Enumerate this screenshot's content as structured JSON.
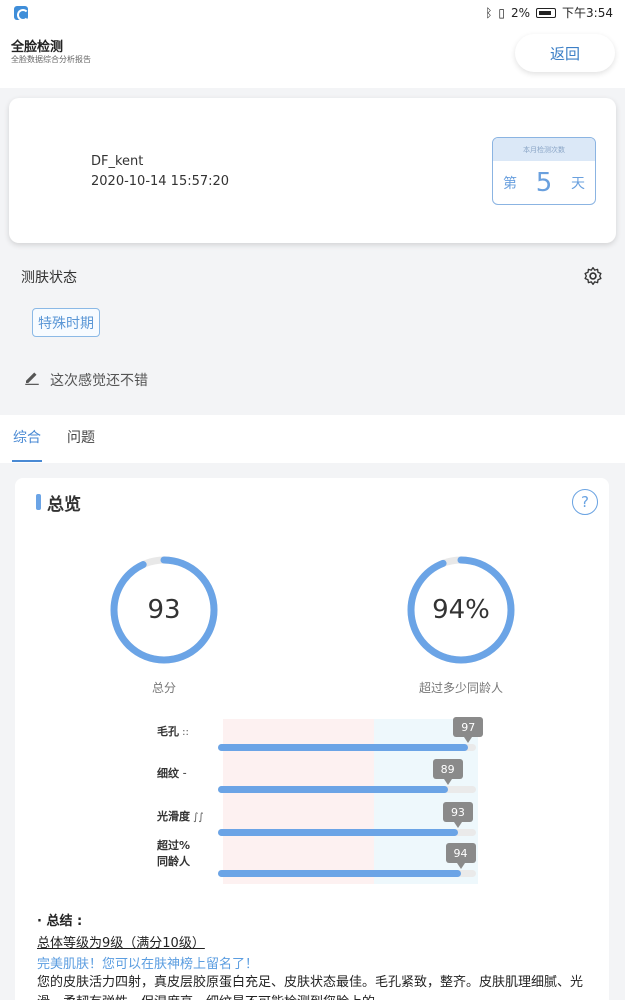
{
  "status_bar": {
    "battery": "2%",
    "time": "下午3:54"
  },
  "header": {
    "title": "全脸检测",
    "subtitle": "全脸数据综合分析报告",
    "back_label": "返回"
  },
  "user": {
    "name": "DF_kent",
    "datetime": "2020-10-14 15:57:20",
    "calendar": {
      "header": "本月检测次数",
      "prefix": "第",
      "count": "5",
      "suffix": "天"
    }
  },
  "skin_status": {
    "label": "测肤状态",
    "tag": "特殊时期",
    "note": "这次感觉还不错"
  },
  "tabs": [
    {
      "label": "综合"
    },
    {
      "label": "问题"
    }
  ],
  "overview": {
    "title": "总览",
    "help": "?",
    "score": {
      "value": "93",
      "fraction": 0.93,
      "caption": "总分"
    },
    "percent": {
      "value": "94%",
      "fraction": 0.94,
      "caption": "超过多少同龄人"
    },
    "metrics": [
      {
        "label": "毛孔",
        "icon": "::",
        "value": "97",
        "fraction": 0.97
      },
      {
        "label": "细纹",
        "icon": "⁃",
        "value": "89",
        "fraction": 0.89
      },
      {
        "label": "光滑度",
        "icon": "∫∫",
        "value": "93",
        "fraction": 0.93
      },
      {
        "label": "超过%\n同龄人",
        "icon": "",
        "value": "94",
        "fraction": 0.94
      }
    ]
  },
  "summary": {
    "heading": "· 总结 :",
    "level": "总体等级为9级（满分10级）",
    "perfect": "完美肌肤！您可以在肤神榜上留名了！",
    "body": "您的皮肤活力四射，真皮层胶原蛋白充足、皮肤状态最佳。毛孔紧致，整齐。皮肤肌理细腻、光滑，柔韧有弹性，保湿度高，细纹是不可能检测到您脸上的。"
  },
  "colors": {
    "accent": "#4a8ad4",
    "ring": "#6ba4e6",
    "ring_track": "#e8e8e8"
  }
}
